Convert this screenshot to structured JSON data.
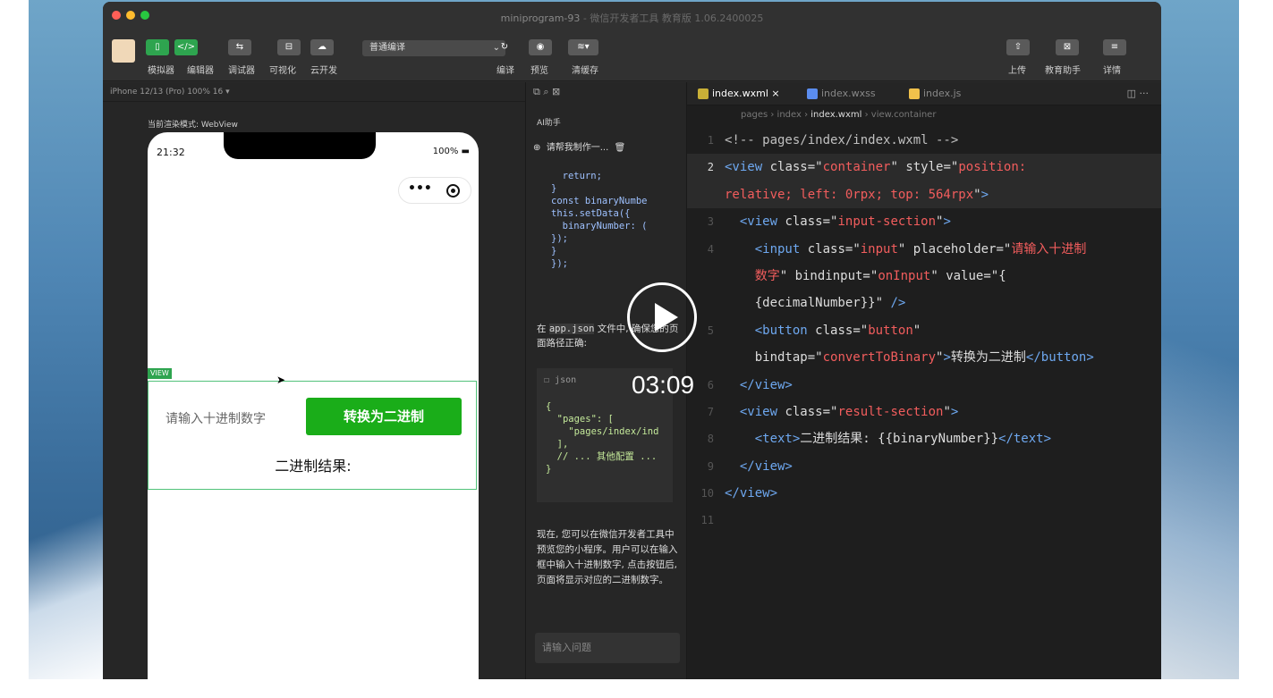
{
  "window": {
    "title": "miniprogram-93",
    "subtitle": "- 微信开发者工具 教育版 1.06.2400025"
  },
  "toolbar": {
    "left_buttons": [
      {
        "label": "模拟器",
        "icon": "phone-icon"
      },
      {
        "label": "编辑器",
        "icon": "code-icon"
      },
      {
        "label": "调试器",
        "icon": "debug-icon"
      },
      {
        "label": "可视化",
        "icon": "layout-icon"
      },
      {
        "label": "云开发",
        "icon": "cloud-icon"
      }
    ],
    "compile_mode": "普通编译",
    "mid_buttons": [
      {
        "label": "编译",
        "icon": "refresh-icon"
      },
      {
        "label": "预览",
        "icon": "eye-icon"
      },
      {
        "label": "清缓存",
        "icon": "layers-icon"
      }
    ],
    "right_buttons": [
      {
        "label": "上传",
        "icon": "upload-icon"
      },
      {
        "label": "教育助手",
        "icon": "education-icon"
      },
      {
        "label": "详情",
        "icon": "menu-icon"
      }
    ]
  },
  "simulator": {
    "device": "iPhone 12/13 (Pro) 100% 16 ▾",
    "render_mode": "当前渲染模式: WebView",
    "time": "21:32",
    "battery": "100%",
    "view_tag": "VIEW",
    "input_placeholder": "请输入十进制数字",
    "convert_button": "转换为二进制",
    "result_label": "二进制结果:"
  },
  "ai_panel": {
    "title": "AI助手",
    "chat_title": "请帮我制作一...",
    "code_snippet": "  return;\n}\nconst binaryNumbe\nthis.setData({\n  binaryNumber: (\n});\n}\n});",
    "text1_prefix": "在 ",
    "text1_code": "app.json",
    "text1_suffix": " 文件中, 确保您的页面路径正确:",
    "json_header": "json",
    "json_code": "{\n  \"pages\": [\n    \"pages/index/ind\n  ],\n  // ... 其他配置 ...\n}",
    "paragraph": "现在, 您可以在微信开发者工具中预览您的小程序。用户可以在输入框中输入十进制数字, 点击按钮后, 页面将显示对应的二进制数字。",
    "input_placeholder": "请输入问题"
  },
  "editor": {
    "tabs": [
      {
        "label": "index.wxml ×",
        "active": true,
        "color": "#f0c14b"
      },
      {
        "label": "index.wxss",
        "active": false,
        "color": "#5b8def"
      },
      {
        "label": "index.js",
        "active": false,
        "color": "#f0c14b"
      }
    ],
    "breadcrumb": "pages › index › ",
    "breadcrumb_file": "index.wxml",
    "breadcrumb_tail": " › view.container",
    "code_lines": [
      {
        "n": "1",
        "html": "<span class=\"cm\">&lt;!-- pages/index/index.wxml --&gt;</span>"
      },
      {
        "n": "2",
        "html": "<span class=\"tag\">&lt;view</span> <span class=\"attr\">class=</span>\"<span class=\"str\">container</span>\" <span class=\"attr\">style=</span>\"<span class=\"str\">position:</span>"
      },
      {
        "n": "",
        "html": "<span class=\"str\">relative; left: 0rpx; top: 564rpx</span>\"<span class=\"tag\">&gt;</span>"
      },
      {
        "n": "3",
        "html": "  <span class=\"tag\">&lt;view</span> <span class=\"attr\">class=</span>\"<span class=\"str\">input-section</span>\"<span class=\"tag\">&gt;</span>"
      },
      {
        "n": "4",
        "html": "    <span class=\"tag\">&lt;input</span> <span class=\"attr\">class=</span>\"<span class=\"str\">input</span>\" <span class=\"attr\">placeholder=</span>\"<span class=\"str\">请输入十进制</span>"
      },
      {
        "n": "",
        "html": "    <span class=\"str\">数字</span>\" <span class=\"attr\">bindinput=</span>\"<span class=\"str\">onInput</span>\" <span class=\"attr\">value=</span>\"{"
      },
      {
        "n": "",
        "html": "    {decimalNumber}}\" <span class=\"tag\">/&gt;</span>"
      },
      {
        "n": "5",
        "html": "    <span class=\"tag\">&lt;button</span> <span class=\"attr\">class=</span>\"<span class=\"str\">button</span>\""
      },
      {
        "n": "",
        "html": "    <span class=\"attr\">bindtap=</span>\"<span class=\"str\">convertToBinary</span>\"<span class=\"tag\">&gt;</span>转换为二进制<span class=\"tag\">&lt;/button&gt;</span>"
      },
      {
        "n": "6",
        "html": "  <span class=\"tag\">&lt;/view&gt;</span>"
      },
      {
        "n": "7",
        "html": "  <span class=\"tag\">&lt;view</span> <span class=\"attr\">class=</span>\"<span class=\"str\">result-section</span>\"<span class=\"tag\">&gt;</span>"
      },
      {
        "n": "8",
        "html": "    <span class=\"tag\">&lt;text&gt;</span>二进制结果: {{binaryNumber}}<span class=\"tag\">&lt;/text&gt;</span>"
      },
      {
        "n": "9",
        "html": "  <span class=\"tag\">&lt;/view&gt;</span>"
      },
      {
        "n": "10",
        "html": "<span class=\"tag\">&lt;/view&gt;</span>"
      },
      {
        "n": "11",
        "html": ""
      }
    ]
  },
  "video": {
    "time": "03:09"
  }
}
